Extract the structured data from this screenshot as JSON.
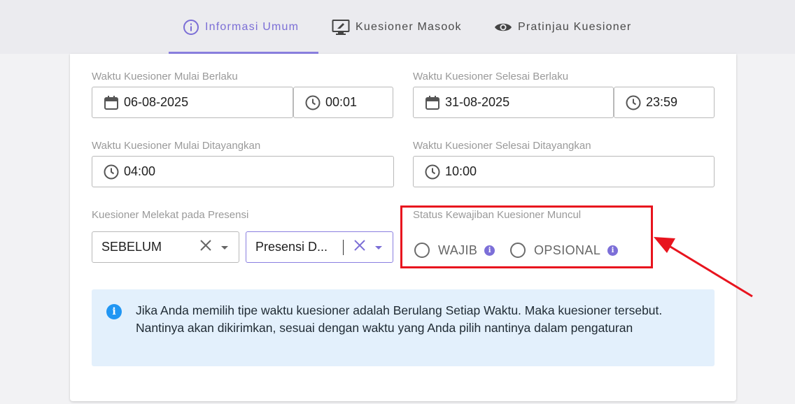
{
  "tabs": [
    {
      "label": "Informasi Umum",
      "icon": "info-circle-icon",
      "active": true
    },
    {
      "label": "Kuesioner Masook",
      "icon": "monitor-edit-icon",
      "active": false
    },
    {
      "label": "Pratinjau Kuesioner",
      "icon": "eye-icon",
      "active": false
    }
  ],
  "form": {
    "start_valid": {
      "label": "Waktu Kuesioner Mulai Berlaku",
      "date": "06-08-2025",
      "time": "00:01"
    },
    "end_valid": {
      "label": "Waktu Kuesioner Selesai Berlaku",
      "date": "31-08-2025",
      "time": "23:59"
    },
    "start_show": {
      "label": "Waktu Kuesioner Mulai Ditayangkan",
      "time": "04:00"
    },
    "end_show": {
      "label": "Waktu Kuesioner Selesai Ditayangkan",
      "time": "10:00"
    },
    "attached": {
      "label": "Kuesioner Melekat pada Presensi",
      "position_value": "SEBELUM",
      "presence_value": "Presensi D..."
    },
    "obligation": {
      "label": "Status Kewajiban Kuesioner Muncul",
      "options": [
        "WAJIB",
        "OPSIONAL"
      ]
    }
  },
  "alert": {
    "text": "Jika Anda memilih tipe waktu kuesioner adalah Berulang Setiap Waktu. Maka kuesioner tersebut. Nantinya akan dikirimkan, sesuai dengan waktu yang Anda pilih nantinya dalam pengaturan"
  },
  "colors": {
    "accent": "#7b6ed6",
    "highlight": "#e8141e",
    "alert_bg": "#e3f0fc",
    "alert_icon": "#2196f3"
  }
}
